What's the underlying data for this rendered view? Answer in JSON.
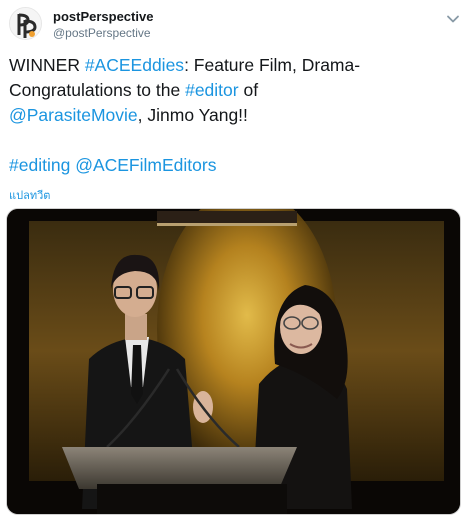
{
  "account": {
    "display_name": "postPerspective",
    "handle": "@postPerspective",
    "avatar_icon": "pp-logo-icon"
  },
  "tweet": {
    "line1_prefix": "WINNER ",
    "line1_hashtag": "#ACEEddies",
    "line1_suffix": ": Feature Film, Drama-",
    "line2_prefix": "Congratulations to the ",
    "line2_hashtag": "#editor",
    "line2_suffix": " of",
    "line3_mention": "@ParasiteMovie",
    "line3_suffix": ", Jinmo Yang!!",
    "line4_hashtag": "#editing",
    "line4_space": " ",
    "line4_mention": "@ACEFilmEditors"
  },
  "translate_label": "แปลทวีต",
  "menu_icon": "chevron-down-icon",
  "colors": {
    "link": "#1b95e0",
    "text": "#14171a",
    "secondary": "#657786"
  }
}
